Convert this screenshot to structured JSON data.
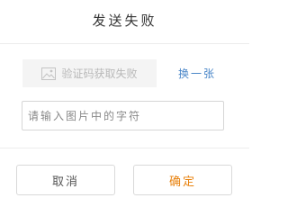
{
  "dialog": {
    "title": "发送失败"
  },
  "captcha": {
    "image_alt_text": "验证码获取失败",
    "image_icon": "broken-image-icon",
    "refresh_label": "换一张",
    "input_placeholder": "请输入图片中的字符",
    "input_value": ""
  },
  "actions": {
    "cancel_label": "取消",
    "confirm_label": "确定"
  },
  "colors": {
    "link": "#4a86c8",
    "confirm_text": "#e8810c",
    "captcha_bg": "#f4f4f4"
  }
}
